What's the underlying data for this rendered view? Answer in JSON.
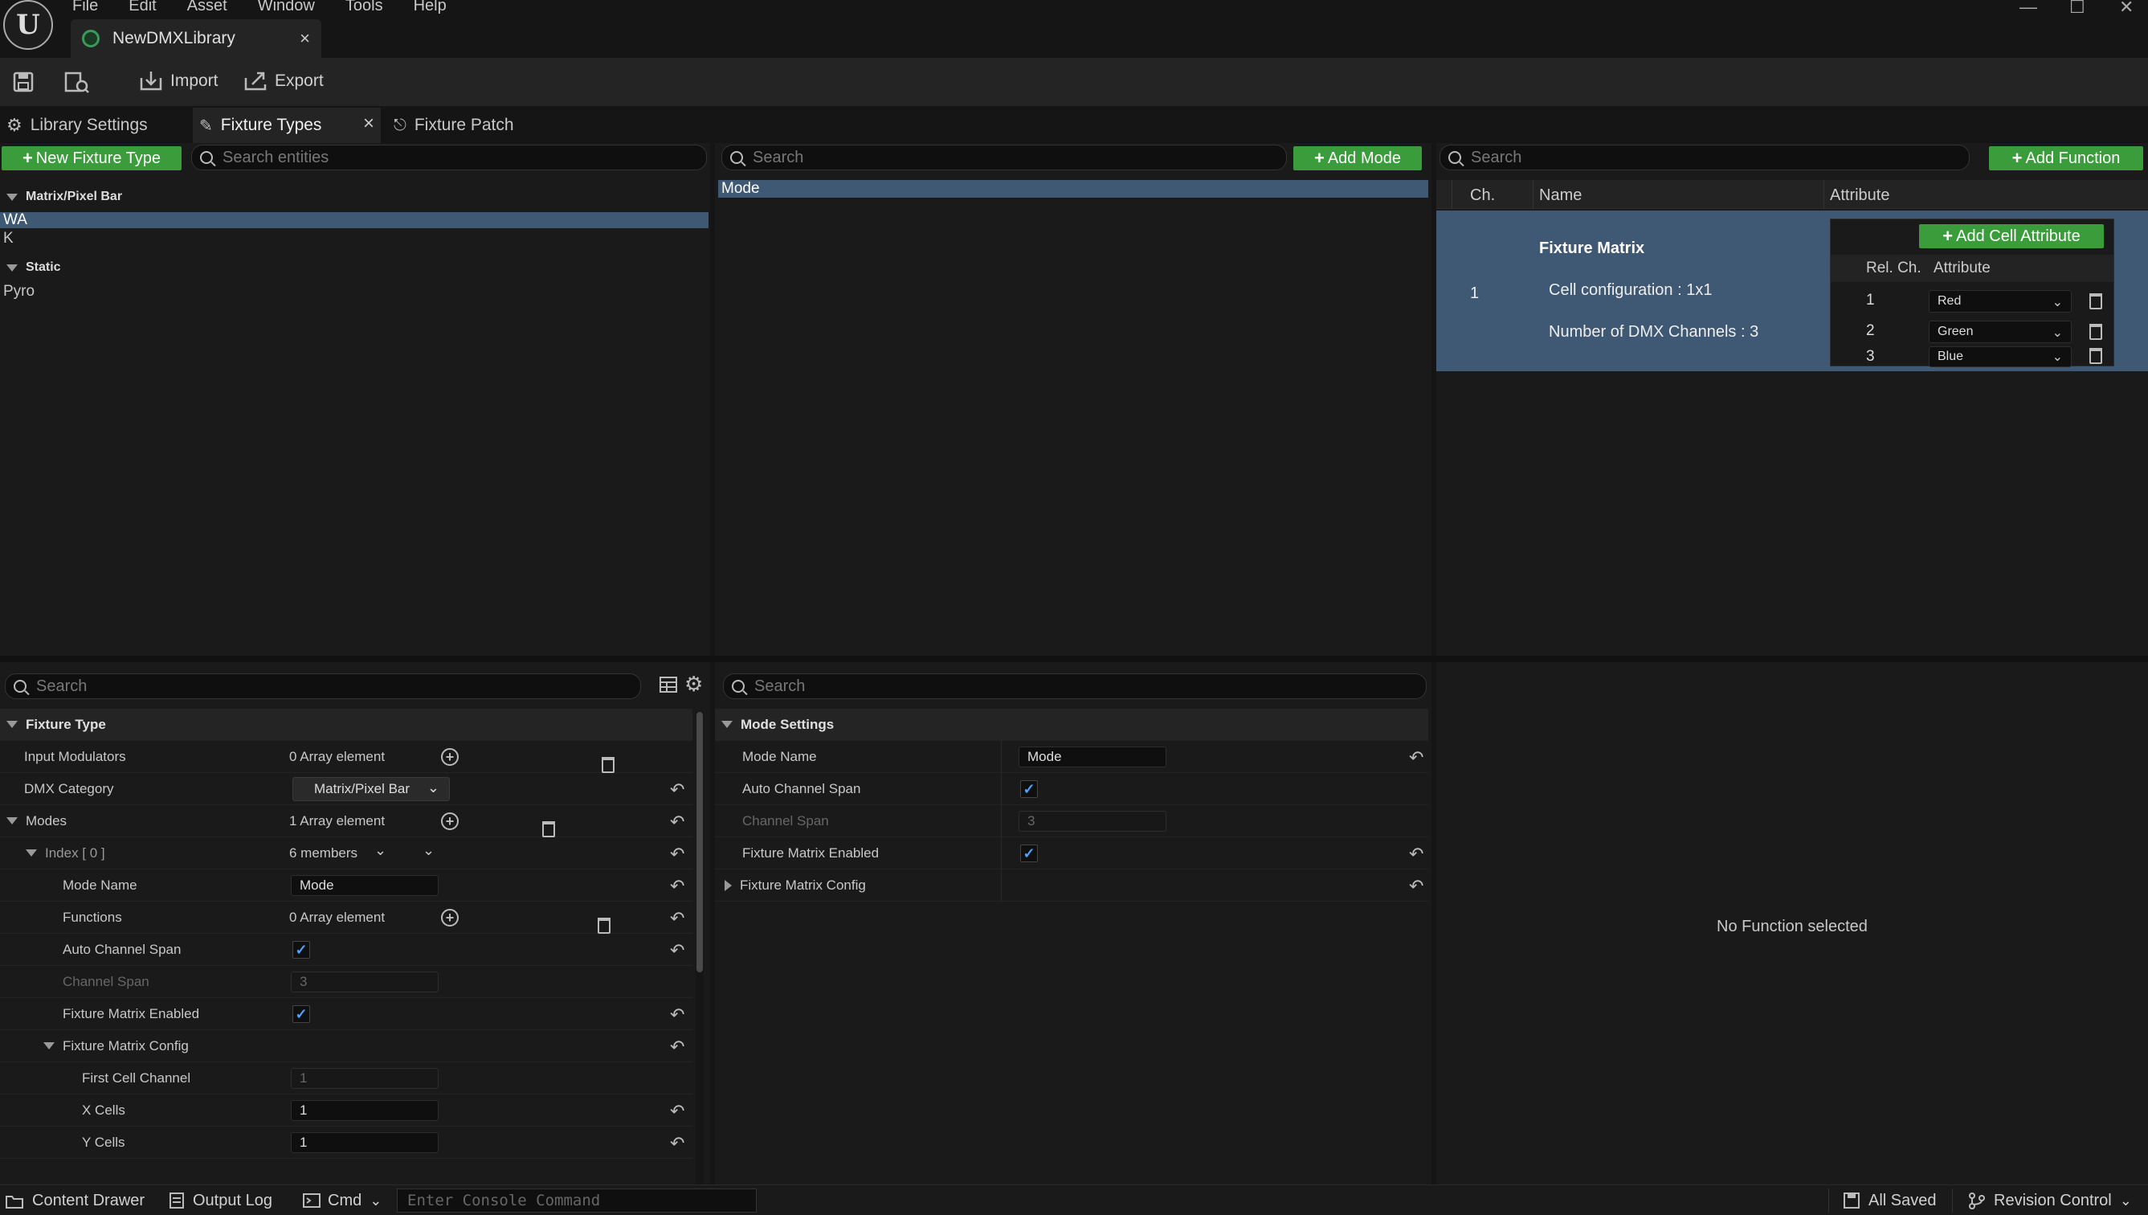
{
  "app": {
    "menu": [
      "File",
      "Edit",
      "Asset",
      "Window",
      "Tools",
      "Help"
    ],
    "document_tab": "NewDMXLibrary",
    "window_controls": {
      "minimize": "—",
      "maximize": "☐",
      "close": "✕"
    }
  },
  "toolbar": {
    "import_label": "Import",
    "export_label": "Export"
  },
  "subtabs": {
    "library_settings": "Library Settings",
    "fixture_types": "Fixture Types",
    "fixture_patch": "Fixture Patch",
    "close": "×"
  },
  "fixture_types_panel": {
    "new_button": "New Fixture Type",
    "search_placeholder": "Search entities",
    "categories": [
      {
        "name": "Matrix/Pixel Bar",
        "items": [
          "WA",
          "K"
        ]
      },
      {
        "name": "Static",
        "items": [
          "Pyro"
        ]
      }
    ]
  },
  "modes_panel": {
    "search_placeholder": "Search",
    "add_button": "Add Mode",
    "items": [
      "Mode"
    ]
  },
  "functions_panel": {
    "search_placeholder": "Search",
    "add_button": "Add Function",
    "columns": [
      "Ch.",
      "Name",
      "Attribute"
    ],
    "matrix": {
      "channel": "1",
      "title": "Fixture Matrix",
      "cell_config": "Cell configuration : 1x1",
      "num_channels": "Number of DMX Channels : 3",
      "add_cell_attribute": "Add Cell Attribute",
      "cell_columns": [
        "Rel. Ch.",
        "Attribute"
      ],
      "cells": [
        {
          "ch": "1",
          "attribute": "Red"
        },
        {
          "ch": "2",
          "attribute": "Green"
        },
        {
          "ch": "3",
          "attribute": "Blue"
        }
      ]
    }
  },
  "fixture_details": {
    "search_placeholder": "Search",
    "rows": {
      "fixture_type": "Fixture Type",
      "input_modulators": "Input Modulators",
      "input_modulators_val": "0 Array element",
      "dmx_category": "DMX Category",
      "dmx_category_val": "Matrix/Pixel Bar",
      "modes": "Modes",
      "modes_val": "1 Array element",
      "index0": "Index [ 0 ]",
      "index0_val": "6 members",
      "mode_name": "Mode Name",
      "mode_name_val": "Mode",
      "functions": "Functions",
      "functions_val": "0 Array element",
      "auto_channel_span": "Auto Channel Span",
      "channel_span": "Channel Span",
      "channel_span_val": "3",
      "fixture_matrix_enabled": "Fixture Matrix Enabled",
      "fixture_matrix_config": "Fixture Matrix Config",
      "first_cell_channel": "First Cell Channel",
      "first_cell_channel_val": "1",
      "x_cells": "X Cells",
      "x_cells_val": "1",
      "y_cells": "Y Cells",
      "y_cells_val": "1"
    }
  },
  "mode_details": {
    "search_placeholder": "Search",
    "rows": {
      "mode_settings": "Mode Settings",
      "mode_name": "Mode Name",
      "mode_name_val": "Mode",
      "auto_channel_span": "Auto Channel Span",
      "channel_span": "Channel Span",
      "channel_span_val": "3",
      "fixture_matrix_enabled": "Fixture Matrix Enabled",
      "fixture_matrix_config": "Fixture Matrix Config"
    }
  },
  "function_details": {
    "empty_text": "No Function selected"
  },
  "statusbar": {
    "content_drawer": "Content Drawer",
    "output_log": "Output Log",
    "cmd": "Cmd",
    "console_placeholder": "Enter Console Command",
    "all_saved": "All Saved",
    "revision_control": "Revision Control"
  },
  "colors": {
    "accent_green": "#3a9c3a",
    "selection": "#3f5874",
    "check": "#4ea3ff"
  }
}
